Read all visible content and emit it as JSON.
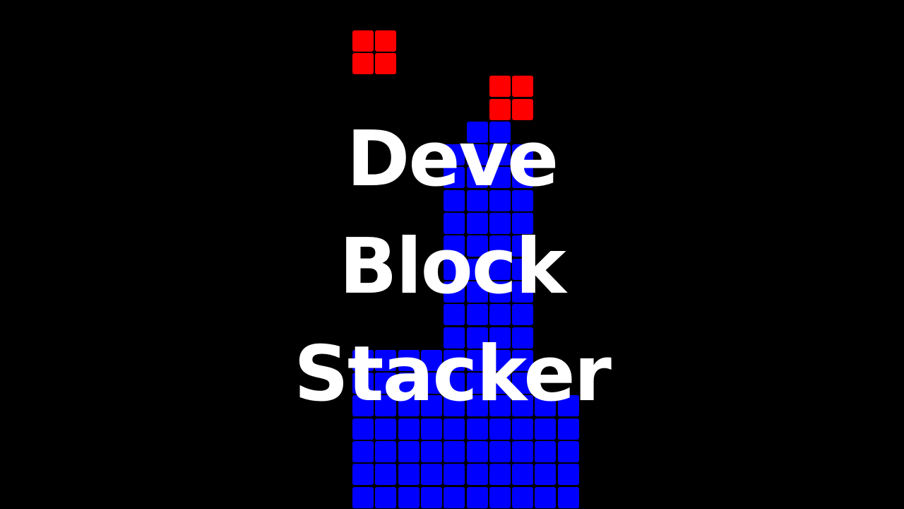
{
  "game": {
    "title_lines": [
      "Deve",
      "Block",
      "Stacker"
    ],
    "colors": {
      "background": "#000000",
      "falling": "#ff0000",
      "stacked": "#0000ff",
      "title": "#ffffff"
    },
    "board": {
      "falling_pieces": [
        {
          "type": "O",
          "col": 0,
          "row": 2
        },
        {
          "type": "O",
          "col": 6,
          "row": 4
        }
      ],
      "stack_columns": [
        {
          "col": 0,
          "from_row": 16
        },
        {
          "col": 1,
          "from_row": 16
        },
        {
          "col": 2,
          "from_row": 16
        },
        {
          "col": 3,
          "from_row": 16
        },
        {
          "col": 4,
          "from_row": 7
        },
        {
          "col": 5,
          "from_row": 6
        },
        {
          "col": 6,
          "from_row": 6
        },
        {
          "col": 7,
          "from_row": 7
        },
        {
          "col": 8,
          "from_row": 18
        },
        {
          "col": 9,
          "from_row": 18
        }
      ]
    }
  }
}
